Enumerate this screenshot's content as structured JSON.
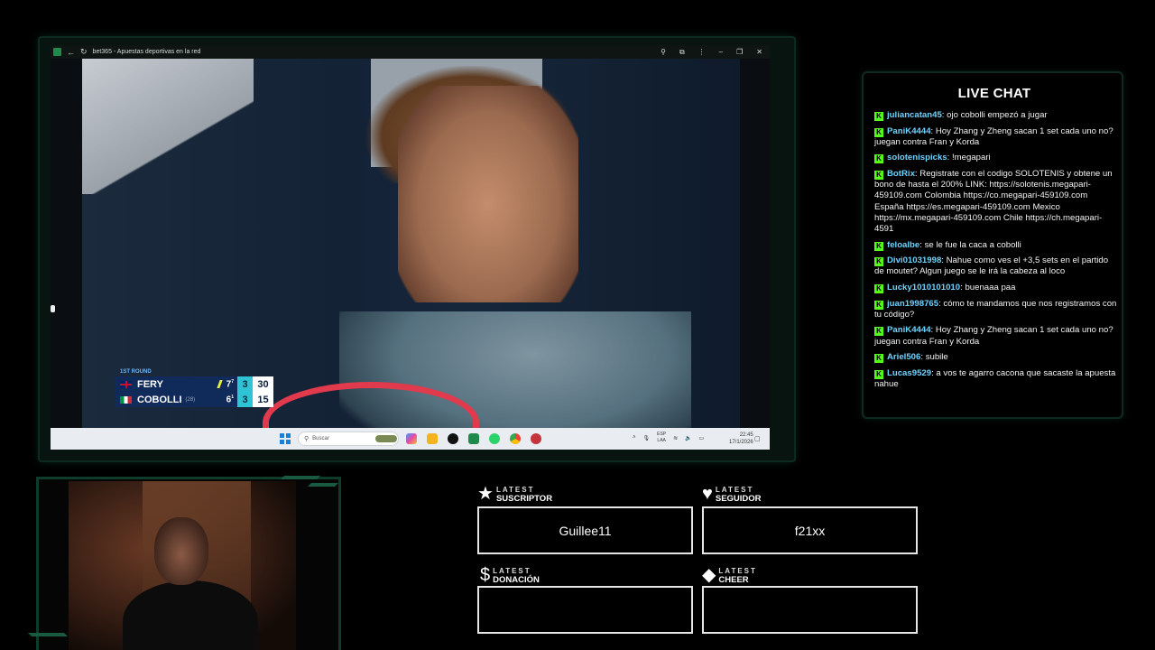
{
  "browser": {
    "title": "bet365 - Apuestas deportivas en la red",
    "back_icon": "arrow-left-icon",
    "refresh_icon": "refresh-icon",
    "zoom_icon": "zoom-icon",
    "extensions_icon": "puzzle-icon",
    "menu_icon": "more-vert-icon",
    "min_label": "–",
    "max_label": "❐",
    "close_label": "✕"
  },
  "scoreboard": {
    "round": "1ST ROUND",
    "players": [
      {
        "name": "FERY",
        "seed": "",
        "set1": "7",
        "set1_tb": "7",
        "set2": "3",
        "points": "30",
        "serving": true
      },
      {
        "name": "COBOLLI",
        "seed": "(28)",
        "set1": "6",
        "set1_tb": "1",
        "set2": "3",
        "points": "15",
        "serving": false
      }
    ]
  },
  "taskbar": {
    "search_placeholder": "Buscar",
    "lang_top": "ESP",
    "lang_bottom": "LAA",
    "time": "22:45",
    "date": "17/1/2026"
  },
  "chat": {
    "title": "LIVE CHAT",
    "messages": [
      {
        "user": "juliancatan45",
        "text": "ojo cobolli empezó a jugar"
      },
      {
        "user": "PaniK4444",
        "text": "Hoy Zhang y Zheng sacan 1 set cada uno no? juegan contra Fran y Korda"
      },
      {
        "user": "solotenispicks",
        "text": "!megapari"
      },
      {
        "user": "BotRix",
        "text": "Registrate con el codigo SOLOTENIS y obtene un bono de hasta el 200% LINK: https://solotenis.megapari-459109.com Colombia https://co.megapari-459109.com España https://es.megapari-459109.com Mexico https://mx.megapari-459109.com Chile https://ch.megapari-4591"
      },
      {
        "user": "feloalbe",
        "text": "se le fue la caca a cobolli"
      },
      {
        "user": "Divi01031998",
        "text": "Nahue como ves el +3,5 sets en el partido de moutet? Algun juego se le irá la cabeza al loco"
      },
      {
        "user": "Lucky1010101010",
        "text": "buenaaa paa"
      },
      {
        "user": "juan1998765",
        "text": "cómo te mandamos que nos registramos con tu código?"
      },
      {
        "user": "PaniK4444",
        "text": "Hoy Zhang y Zheng sacan 1 set cada uno no? juegan contra Fran y Korda"
      },
      {
        "user": "Ariel506",
        "text": "subile"
      },
      {
        "user": "Lucas9529",
        "text": "a vos te agarro cacona que sacaste la apuesta nahue"
      }
    ]
  },
  "widgets": {
    "suscriptor": {
      "small": "LATEST",
      "big": "SUSCRIPTOR",
      "icon": "star-icon",
      "glyph": "★",
      "value": "Guillee11"
    },
    "seguidor": {
      "small": "LATEST",
      "big": "SEGUIDOR",
      "icon": "heart-icon",
      "glyph": "♥",
      "value": "f21xx"
    },
    "donacion": {
      "small": "LATEST",
      "big": "DONACIÓN",
      "icon": "dollar-icon",
      "glyph": "$",
      "value": ""
    },
    "cheer": {
      "small": "LATEST",
      "big": "CHEER",
      "icon": "diamond-icon",
      "glyph": "◆",
      "value": ""
    }
  },
  "colors": {
    "kick_green": "#53fc18",
    "frame_green": "#0f3c2a",
    "username_blue": "#6fd3ff"
  }
}
